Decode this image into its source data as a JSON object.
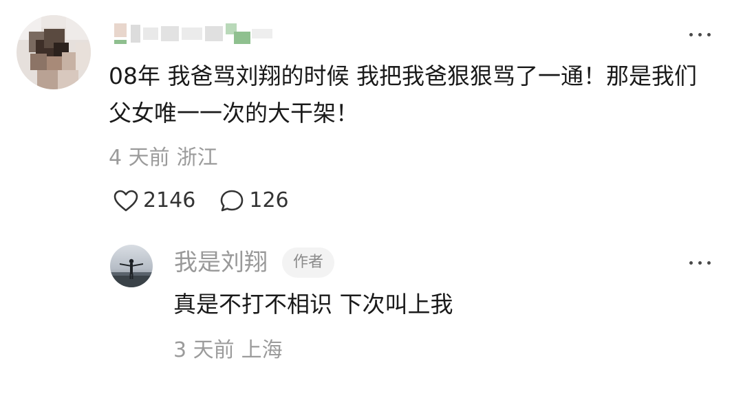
{
  "comments": [
    {
      "username": "",
      "username_blurred": true,
      "body": "08年 我爸骂刘翔的时候 我把我爸狠狠骂了一通！那是我们父女唯一一次的大干架！",
      "time": "4 天前",
      "location": "浙江",
      "likes": "2146",
      "replies": "126",
      "icons": {
        "like": "heart-icon",
        "reply": "comment-bubble-icon",
        "more": "more-dots-icon"
      }
    }
  ],
  "reply": {
    "username": "我是刘翔",
    "badge": "作者",
    "body": "真是不打不相识 下次叫上我",
    "time": "3 天前",
    "location": "上海",
    "icons": {
      "more": "more-dots-icon"
    }
  },
  "colors": {
    "text": "#1a1a1a",
    "muted": "#9b9b9b",
    "badge_bg": "#f3f3f3"
  }
}
